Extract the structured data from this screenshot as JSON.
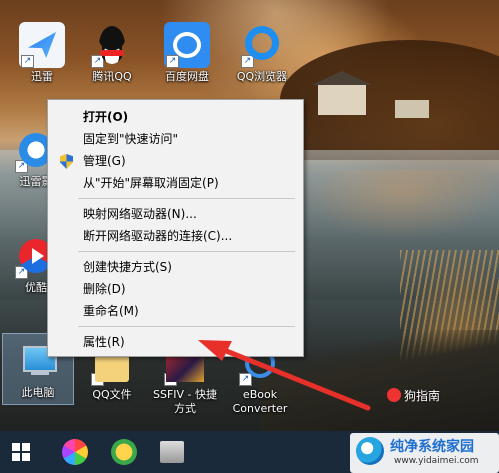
{
  "desktop": {
    "icons": [
      {
        "label": "迅雷"
      },
      {
        "label": "腾讯QQ"
      },
      {
        "label": "百度网盘"
      },
      {
        "label": "QQ浏览器"
      },
      {
        "label": "迅雷影"
      },
      {
        "label": "优酷"
      },
      {
        "label": "此电脑"
      },
      {
        "label": "QQ文件"
      },
      {
        "label": "SSFIV - 快捷方式"
      },
      {
        "label": "eBook Converter"
      }
    ]
  },
  "context_menu": {
    "items": [
      {
        "label": "打开(O)"
      },
      {
        "label": "固定到\"快速访问\""
      },
      {
        "label": "管理(G)"
      },
      {
        "label": "从\"开始\"屏幕取消固定(P)"
      },
      {
        "label": "映射网络驱动器(N)..."
      },
      {
        "label": "断开网络驱动器的连接(C)..."
      },
      {
        "label": "创建快捷方式(S)"
      },
      {
        "label": "删除(D)"
      },
      {
        "label": "重命名(M)"
      },
      {
        "label": "属性(R)"
      }
    ]
  },
  "watermarks": {
    "guide": "狗指南",
    "site_title": "纯净系统家园",
    "site_url": "www.yidaimei.com"
  },
  "colors": {
    "arrow": "#e8302b",
    "taskbar": "#1b2a3a",
    "menu_bg": "#f2f2f2"
  }
}
